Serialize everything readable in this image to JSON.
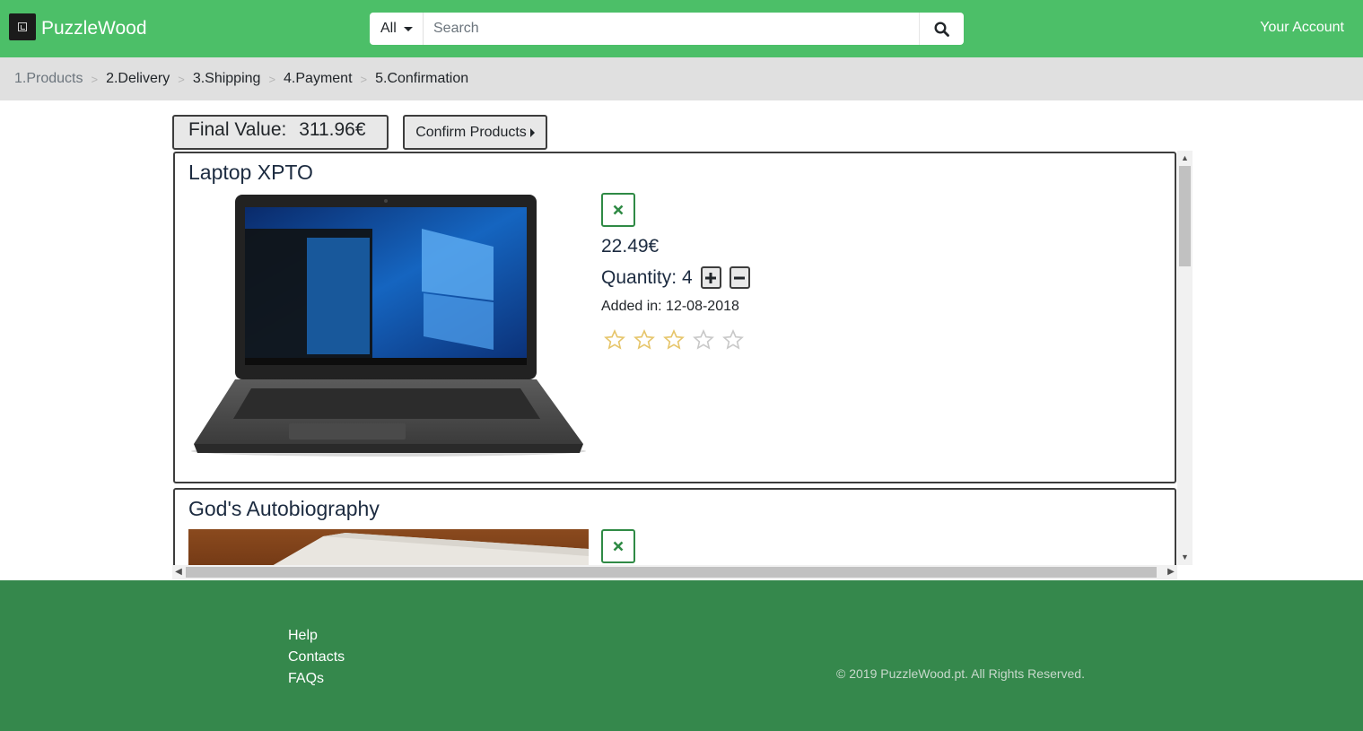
{
  "header": {
    "brand": "PuzzleWood",
    "category": "All",
    "search_placeholder": "Search",
    "account": "Your Account"
  },
  "breadcrumb": [
    "1.Products",
    "2.Delivery",
    "3.Shipping",
    "4.Payment",
    "5.Confirmation"
  ],
  "summary": {
    "final_label": "Final Value:",
    "final_value": "311.96€",
    "confirm_label": "Confirm Products"
  },
  "products": [
    {
      "title": "Laptop XPTO",
      "price": "22.49€",
      "quantity_label": "Quantity:",
      "quantity": "4",
      "added": "Added in: 12-08-2018",
      "rating": 0,
      "rating_max": 5
    },
    {
      "title": "God's Autobiography"
    }
  ],
  "footer": {
    "links": [
      "Help",
      "Contacts",
      "FAQs"
    ],
    "copyright": "© 2019 PuzzleWood.pt. All Rights Reserved."
  },
  "colors": {
    "navbar": "#4cbf68",
    "footer": "#35884c",
    "breadcrumb_bg": "#e0e0e0",
    "remove_icon": "#2f8a45",
    "star_outline": "#e6c56a"
  },
  "icons": {
    "search": "search-icon",
    "remove": "close-icon",
    "increase": "plus-icon",
    "decrease": "minus-icon",
    "rating": "star-icon"
  }
}
